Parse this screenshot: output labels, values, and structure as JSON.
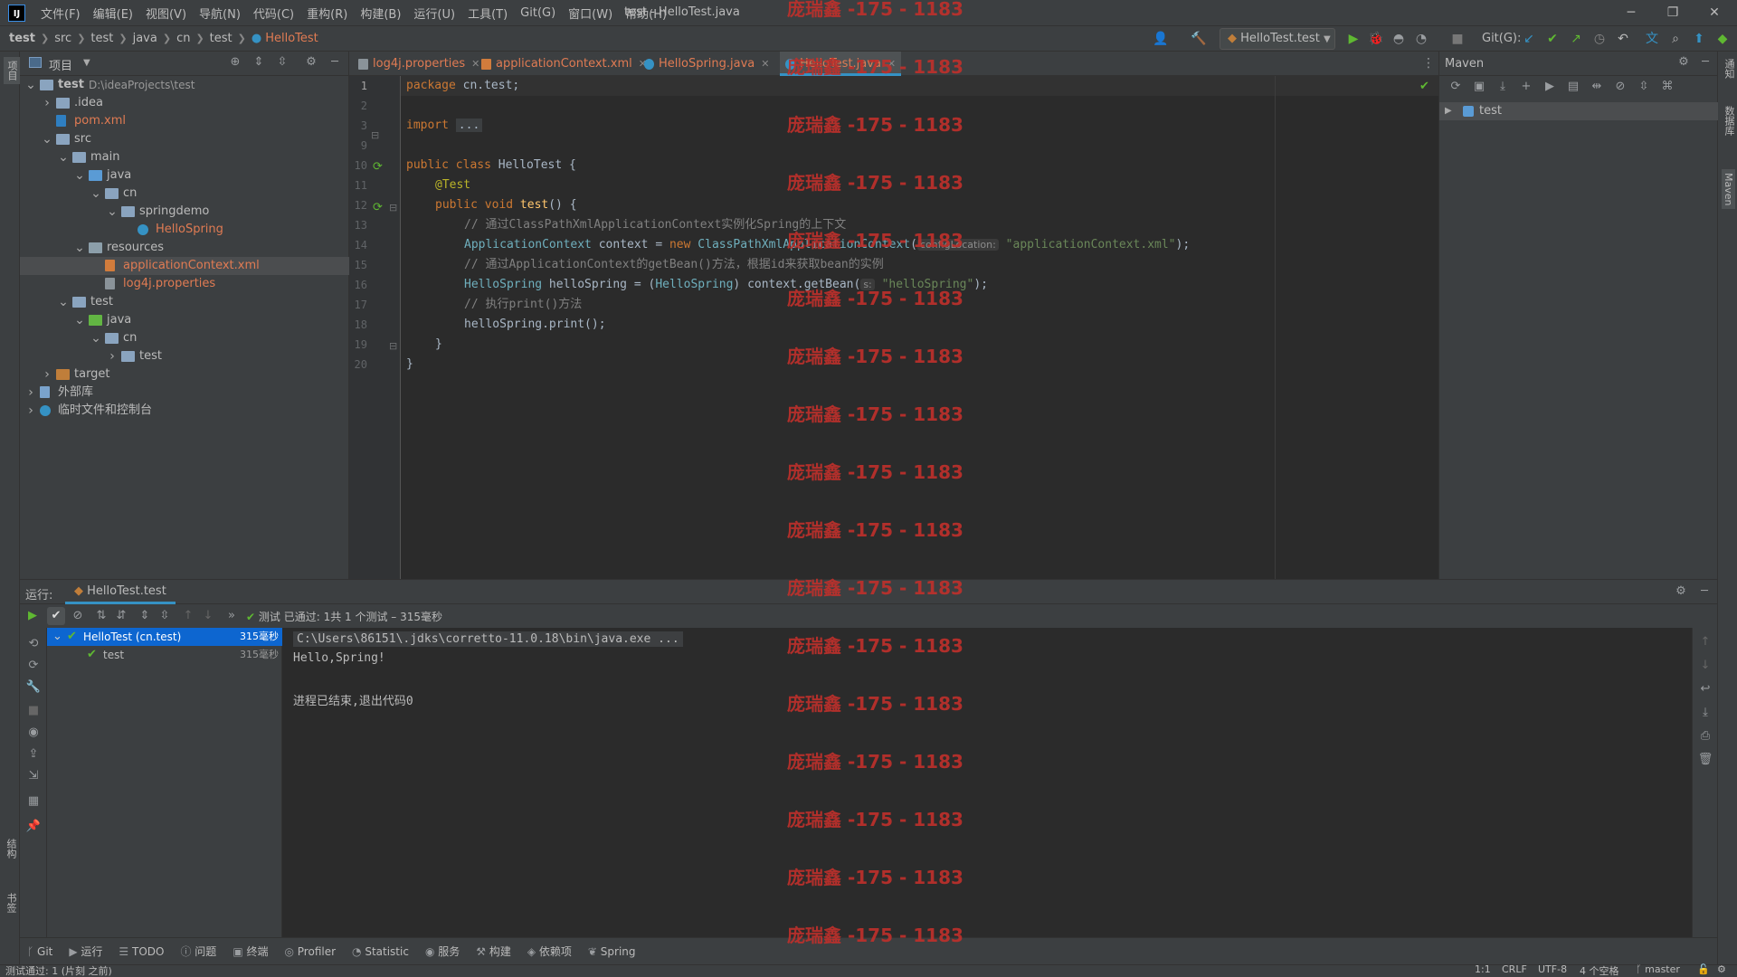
{
  "window": {
    "title": "test - HelloTest.java",
    "menu": [
      "文件(F)",
      "编辑(E)",
      "视图(V)",
      "导航(N)",
      "代码(C)",
      "重构(R)",
      "构建(B)",
      "运行(U)",
      "工具(T)",
      "Git(G)",
      "窗口(W)",
      "帮助(H)"
    ],
    "controls": {
      "minimize": "─",
      "restore": "❐",
      "close": "✕"
    }
  },
  "breadcrumb": [
    "test",
    "src",
    "test",
    "java",
    "cn",
    "test",
    "HelloTest"
  ],
  "toolbar": {
    "run_config": "HelloTest.test",
    "git_label": "Git(G):"
  },
  "left_strip": {
    "project": "项目",
    "structure": "结构",
    "bookmarks": "书签"
  },
  "right_strip": {
    "notifications": "通知",
    "database": "数据库",
    "maven": "Maven"
  },
  "project_panel": {
    "title": "项目",
    "tree": [
      {
        "label": "test",
        "suffix": "D:\\ideaProjects\\test",
        "depth": 0,
        "arrow": "open",
        "icon": "folder-module",
        "bold": true
      },
      {
        "label": ".idea",
        "depth": 1,
        "arrow": "closed",
        "icon": "folder"
      },
      {
        "label": "pom.xml",
        "depth": 1,
        "arrow": "none",
        "icon": "maven-file",
        "color": "#e07b53"
      },
      {
        "label": "src",
        "depth": 1,
        "arrow": "open",
        "icon": "folder"
      },
      {
        "label": "main",
        "depth": 2,
        "arrow": "open",
        "icon": "folder"
      },
      {
        "label": "java",
        "depth": 3,
        "arrow": "open",
        "icon": "folder-blue"
      },
      {
        "label": "cn",
        "depth": 4,
        "arrow": "open",
        "icon": "package"
      },
      {
        "label": "springdemo",
        "depth": 5,
        "arrow": "open",
        "icon": "package"
      },
      {
        "label": "HelloSpring",
        "depth": 6,
        "arrow": "none",
        "icon": "class-file",
        "color": "#e07b53"
      },
      {
        "label": "resources",
        "depth": 3,
        "arrow": "open",
        "icon": "folder-res"
      },
      {
        "label": "applicationContext.xml",
        "depth": 4,
        "arrow": "none",
        "icon": "xml-file",
        "color": "#e07b53",
        "selected": true
      },
      {
        "label": "log4j.properties",
        "depth": 4,
        "arrow": "none",
        "icon": "props-file",
        "color": "#e07b53"
      },
      {
        "label": "test",
        "depth": 2,
        "arrow": "open",
        "icon": "folder"
      },
      {
        "label": "java",
        "depth": 3,
        "arrow": "open",
        "icon": "folder-green"
      },
      {
        "label": "cn",
        "depth": 4,
        "arrow": "open",
        "icon": "package"
      },
      {
        "label": "test",
        "depth": 5,
        "arrow": "closed",
        "icon": "package"
      },
      {
        "label": "target",
        "depth": 1,
        "arrow": "closed",
        "icon": "folder-orange"
      },
      {
        "label": "外部库",
        "depth": 0,
        "arrow": "closed",
        "icon": "library"
      },
      {
        "label": "临时文件和控制台",
        "depth": 0,
        "arrow": "closed",
        "icon": "scratch"
      }
    ]
  },
  "editor_tabs": [
    {
      "label": "log4j.properties",
      "icon": "props-file",
      "active": false
    },
    {
      "label": "applicationContext.xml",
      "icon": "xml-file",
      "active": false
    },
    {
      "label": "HelloSpring.java",
      "icon": "class-file",
      "active": false
    },
    {
      "label": "HelloTest.java",
      "icon": "class-file",
      "active": true
    }
  ],
  "code": {
    "line_numbers": [
      "1",
      "2",
      "3",
      "9",
      "10",
      "11",
      "12",
      "13",
      "14",
      "15",
      "16",
      "17",
      "18",
      "19",
      "20"
    ],
    "package_kw": "package",
    "package_name": "cn.test;",
    "import_kw": "import",
    "import_fold": "...",
    "class_decl_kw": "public class",
    "class_name": "HelloTest",
    "brace_open": "{",
    "annotation": "@Test",
    "method_kw": "public void",
    "method_name": "test",
    "method_rest": "() {",
    "comment1": "// 通过ClassPathXmlApplicationContext实例化Spring的上下文",
    "l13_type": "ApplicationContext",
    "l13_var": " context = ",
    "l13_new": "new",
    "l13_cls": "ClassPathXmlApplicationContext",
    "l13_paren": "(",
    "l13_hint": "configLocation:",
    "l13_str": "\"applicationContext.xml\"",
    "l13_end": ");",
    "comment2": "// 通过ApplicationContext的getBean()方法，根据id来获取bean的实例",
    "l15_type": "HelloSpring",
    "l15_var": " helloSpring = (",
    "l15_cast": "HelloSpring",
    "l15_mid": ") context.getBean(",
    "l15_hint": "s:",
    "l15_str": "\"helloSpring\"",
    "l15_end": ");",
    "comment3": "// 执行print()方法",
    "l17": "helloSpring.print();",
    "close_method": "}",
    "close_class": "}"
  },
  "maven_panel": {
    "title": "Maven",
    "root": "test"
  },
  "run_panel": {
    "label": "运行:",
    "tab": "HelloTest.test",
    "status": "测试 已通过: 1共 1 个测试 – 315毫秒",
    "tree": [
      {
        "label": "HelloTest (cn.test)",
        "time": "315毫秒",
        "selected": true
      },
      {
        "label": "test",
        "time": "315毫秒",
        "selected": false
      }
    ],
    "console": [
      "C:\\Users\\86151\\.jdks\\corretto-11.0.18\\bin\\java.exe ...",
      "Hello,Spring!",
      "",
      "进程已结束,退出代码0"
    ]
  },
  "bottom_tools": [
    "Git",
    "运行",
    "TODO",
    "问题",
    "终端",
    "Profiler",
    "Statistic",
    "服务",
    "构建",
    "依赖项",
    "Spring"
  ],
  "status_bar": {
    "left": "测试通过: 1 (片刻 之前)",
    "pos": "1:1",
    "eol": "CRLF",
    "enc": "UTF-8",
    "indent": "4 个空格",
    "branch": "master"
  },
  "watermark": "庞瑞鑫 -175 - 1183",
  "colors": {
    "accent": "#3592c4",
    "selection": "#0d66d0",
    "pass": "#5fb832",
    "watermark": "#c0302b"
  }
}
